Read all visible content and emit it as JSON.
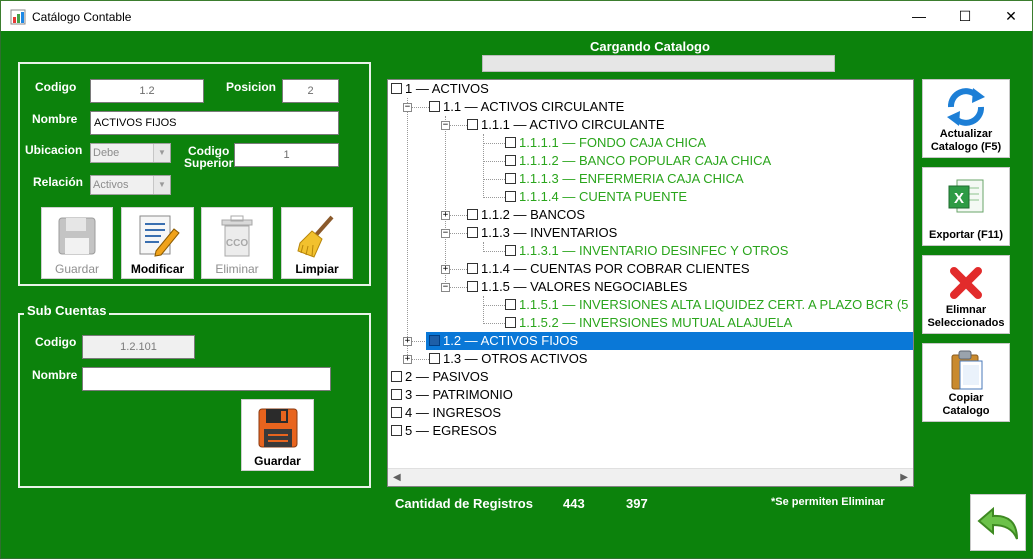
{
  "window": {
    "title": "Catálogo Contable",
    "minimize": "—",
    "maximize": "☐",
    "close": "✕"
  },
  "status": {
    "loading_label": "Cargando Catalogo",
    "progress": 0.0
  },
  "form": {
    "codigo_label": "Codigo",
    "codigo_value": "1.2",
    "posicion_label": "Posicion",
    "posicion_value": "2",
    "nombre_label": "Nombre",
    "nombre_value": "ACTIVOS FIJOS",
    "ubicacion_label": "Ubicacion",
    "ubicacion_value": "Debe",
    "codigo_superior_label_1": "Codigo",
    "codigo_superior_label_2": "Superior",
    "codigo_superior_value": "1",
    "relacion_label": "Relación",
    "relacion_value": "Activos",
    "buttons": {
      "guardar": "Guardar",
      "modificar": "Modificar",
      "eliminar": "Eliminar",
      "limpiar": "Limpiar"
    }
  },
  "subcuentas": {
    "title": "Sub Cuentas",
    "codigo_label": "Codigo",
    "codigo_value": "1.2.101",
    "nombre_label": "Nombre",
    "nombre_value": "",
    "guardar": "Guardar"
  },
  "tree": [
    "1 — ACTIVOS",
    "1.1 — ACTIVOS CIRCULANTE",
    "1.1.1 — ACTIVO CIRCULANTE",
    "1.1.1.1 — FONDO CAJA CHICA",
    "1.1.1.2 — BANCO POPULAR CAJA CHICA",
    "1.1.1.3 — ENFERMERIA CAJA CHICA",
    "1.1.1.4 — CUENTA PUENTE",
    "1.1.2 — BANCOS",
    "1.1.3 — INVENTARIOS",
    "1.1.3.1 — INVENTARIO DESINFEC Y OTROS",
    "1.1.4 — CUENTAS POR COBRAR CLIENTES",
    "1.1.5 — VALORES NEGOCIABLES",
    "1.1.5.1 — INVERSIONES ALTA LIQUIDEZ CERT. A PLAZO BCR (5",
    "1.1.5.2 — INVERSIONES MUTUAL ALAJUELA",
    "1.2 — ACTIVOS FIJOS",
    "1.3 — OTROS ACTIVOS",
    "2 — PASIVOS",
    "3 — PATRIMONIO",
    "4 — INGRESOS",
    "5 — EGRESOS"
  ],
  "right_buttons": {
    "actualizar_1": "Actualizar",
    "actualizar_2": "Catalogo (F5)",
    "exportar": "Exportar (F11)",
    "eliminar_1": "Elimnar",
    "eliminar_2": "Seleccionados",
    "copiar_1": "Copiar",
    "copiar_2": "Catalogo"
  },
  "footer": {
    "cantidad_label": "Cantidad de Registros",
    "count_1": "443",
    "count_2": "397",
    "note": "*Se permiten Eliminar"
  },
  "colors": {
    "background": "#0c820c",
    "selected": "#0a78d7",
    "leaf_text": "#2aa51c"
  }
}
